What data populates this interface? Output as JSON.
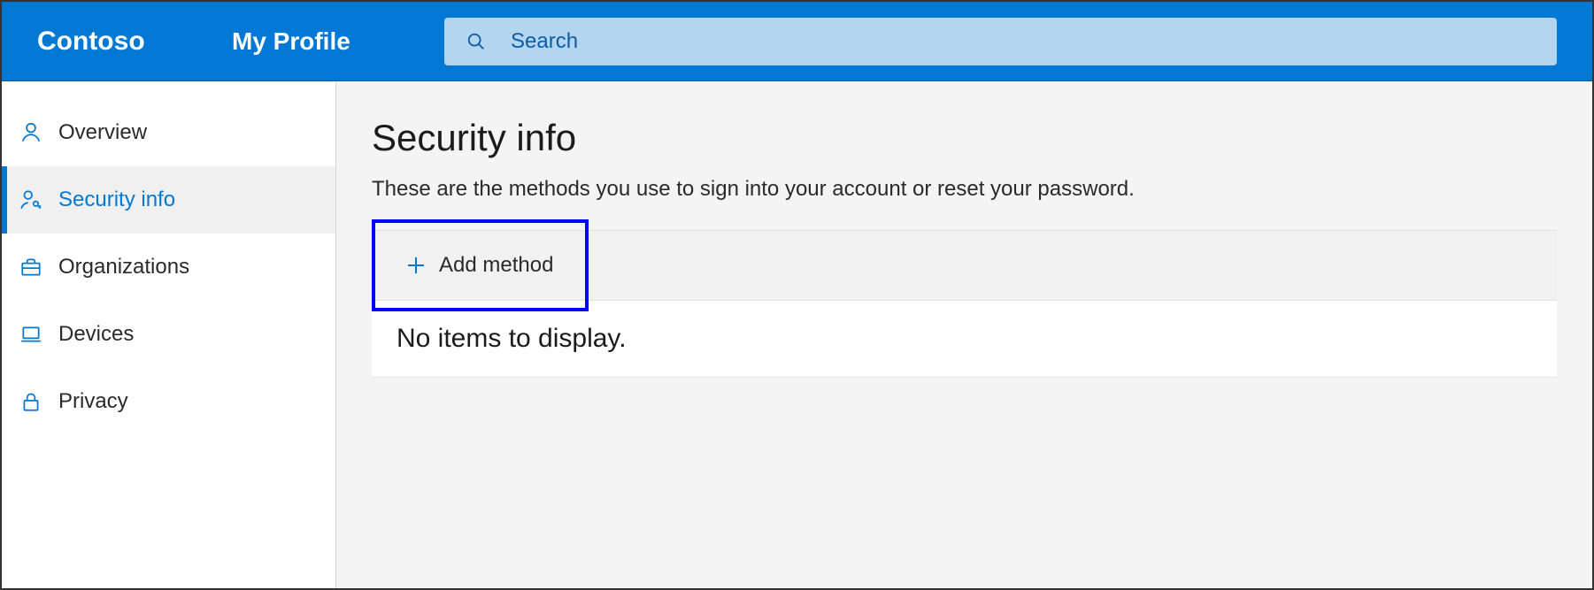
{
  "header": {
    "brand": "Contoso",
    "page": "My Profile",
    "search_placeholder": "Search"
  },
  "sidebar": {
    "items": [
      {
        "label": "Overview",
        "icon": "person-icon",
        "active": false
      },
      {
        "label": "Security info",
        "icon": "person-key-icon",
        "active": true
      },
      {
        "label": "Organizations",
        "icon": "briefcase-icon",
        "active": false
      },
      {
        "label": "Devices",
        "icon": "laptop-icon",
        "active": false
      },
      {
        "label": "Privacy",
        "icon": "lock-icon",
        "active": false
      }
    ]
  },
  "main": {
    "title": "Security info",
    "subtitle": "These are the methods you use to sign into your account or reset your password.",
    "add_method_label": "Add method",
    "empty_message": "No items to display."
  },
  "colors": {
    "primary": "#0078d4",
    "highlight": "#0000ff"
  }
}
